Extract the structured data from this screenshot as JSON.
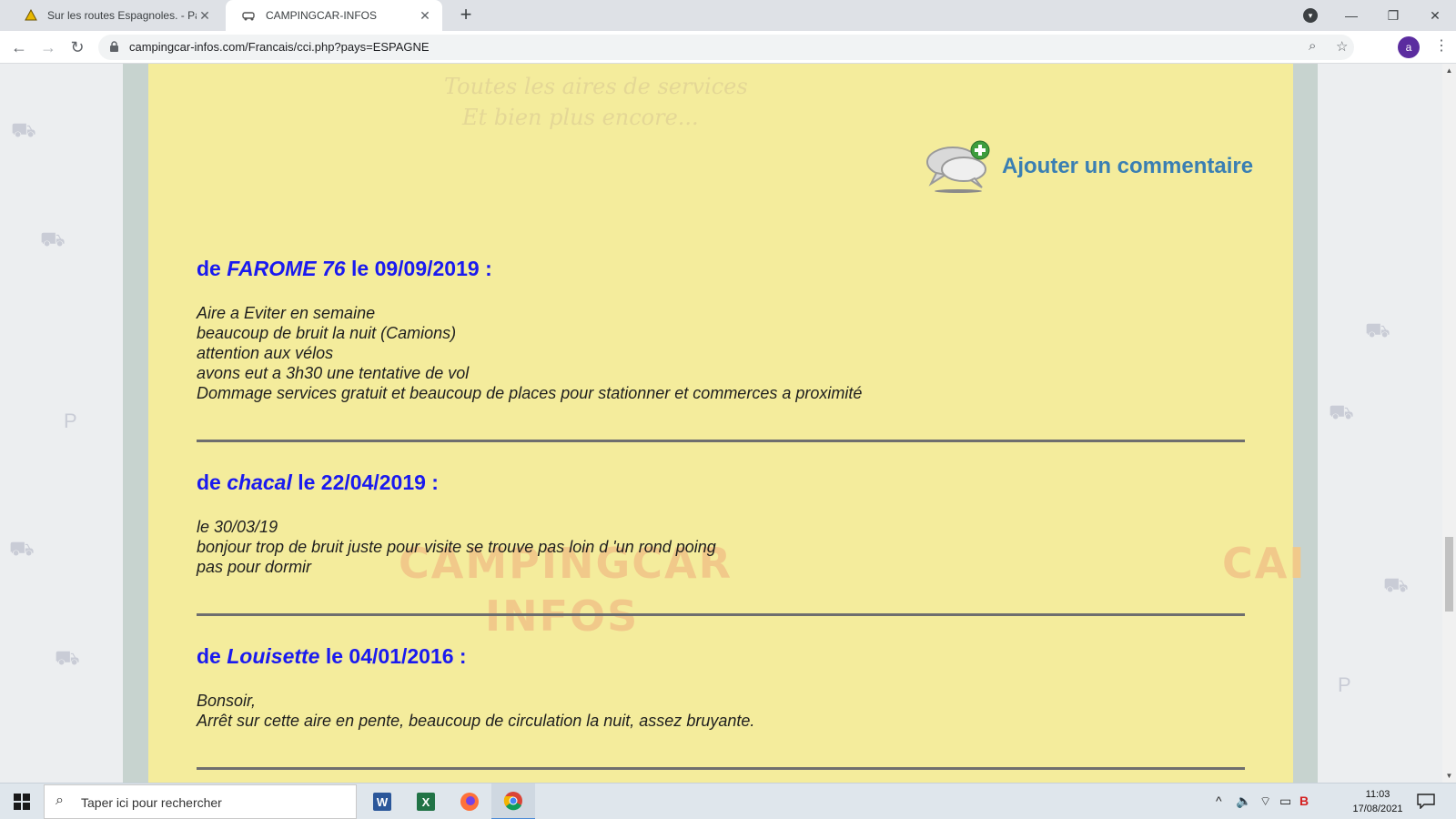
{
  "browser": {
    "tabs": [
      {
        "title": "Sur les routes Espagnoles. - Page",
        "active": false
      },
      {
        "title": "CAMPINGCAR-INFOS",
        "active": true
      }
    ],
    "new_tab_label": "+",
    "url": "campingcar-infos.com/Francais/cci.php?pays=ESPAGNE",
    "profile_initial": "a"
  },
  "page": {
    "slogan_line1": "Toutes les aires de services",
    "slogan_line2": "Et bien plus encore...",
    "bg_logo_line1": "CAMPINGCAR",
    "bg_logo_line2": "INFOS",
    "bg_logo_right": "CAI",
    "add_comment_label": "Ajouter un commentaire",
    "comments": [
      {
        "prefix": "de",
        "author": "FAROME 76",
        "date_part": "le 09/09/2019 :",
        "lines": [
          "Aire a Eviter en semaine",
          "beaucoup de bruit la nuit (Camions)",
          "attention aux vélos",
          "avons eut a 3h30 une tentative de vol",
          "Dommage services gratuit et beaucoup de places pour stationner et commerces a proximité"
        ]
      },
      {
        "prefix": "de",
        "author": "chacal",
        "date_part": "le 22/04/2019 :",
        "lines": [
          "le 30/03/19",
          "bonjour trop de bruit juste pour visite se trouve pas loin d 'un rond poing",
          "pas pour dormir"
        ]
      },
      {
        "prefix": "de",
        "author": "Louisette",
        "date_part": "le 04/01/2016 :",
        "lines": [
          "Bonsoir,",
          "Arrêt sur cette aire en pente, beaucoup de circulation la nuit, assez bruyante."
        ]
      }
    ]
  },
  "taskbar": {
    "search_placeholder": "Taper ici pour rechercher",
    "apps": [
      "word-icon",
      "excel-icon",
      "firefox-icon",
      "chrome-icon"
    ],
    "time": "11:03",
    "date": "17/08/2021"
  },
  "colors": {
    "content_bg": "#f4ec9c",
    "comment_header": "#1a1aef",
    "add_comment_link": "#3a7fb3"
  }
}
